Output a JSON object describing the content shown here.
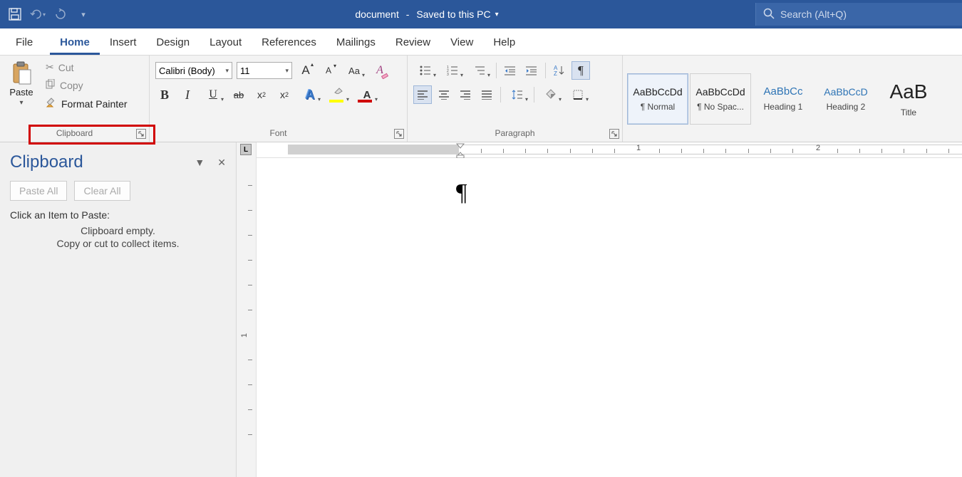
{
  "titlebar": {
    "doc_name": "document",
    "save_status": "Saved to this PC",
    "search_placeholder": "Search (Alt+Q)"
  },
  "tabs": {
    "file": "File",
    "home": "Home",
    "insert": "Insert",
    "design": "Design",
    "layout": "Layout",
    "references": "References",
    "mailings": "Mailings",
    "review": "Review",
    "view": "View",
    "help": "Help"
  },
  "ribbon": {
    "clipboard": {
      "paste": "Paste",
      "cut": "Cut",
      "copy": "Copy",
      "format_painter": "Format Painter",
      "label": "Clipboard"
    },
    "font": {
      "name": "Calibri (Body)",
      "size": "11",
      "label": "Font",
      "aa": "Aa"
    },
    "paragraph": {
      "label": "Paragraph"
    },
    "styles": {
      "items": [
        {
          "preview": "AaBbCcDd",
          "name": "¶ Normal"
        },
        {
          "preview": "AaBbCcDd",
          "name": "¶ No Spac..."
        },
        {
          "preview": "AaBbCc",
          "name": "Heading 1"
        },
        {
          "preview": "AaBbCcD",
          "name": "Heading 2"
        },
        {
          "preview": "AaB",
          "name": "Title"
        }
      ]
    }
  },
  "sidepane": {
    "title": "Clipboard",
    "paste_all": "Paste All",
    "clear_all": "Clear All",
    "click_item": "Click an Item to Paste:",
    "empty1": "Clipboard empty.",
    "empty2": "Copy or cut to collect items."
  },
  "ruler": {
    "h_marks": [
      "1",
      "2"
    ],
    "corner": "L"
  },
  "page": {
    "content_mark": "¶"
  }
}
